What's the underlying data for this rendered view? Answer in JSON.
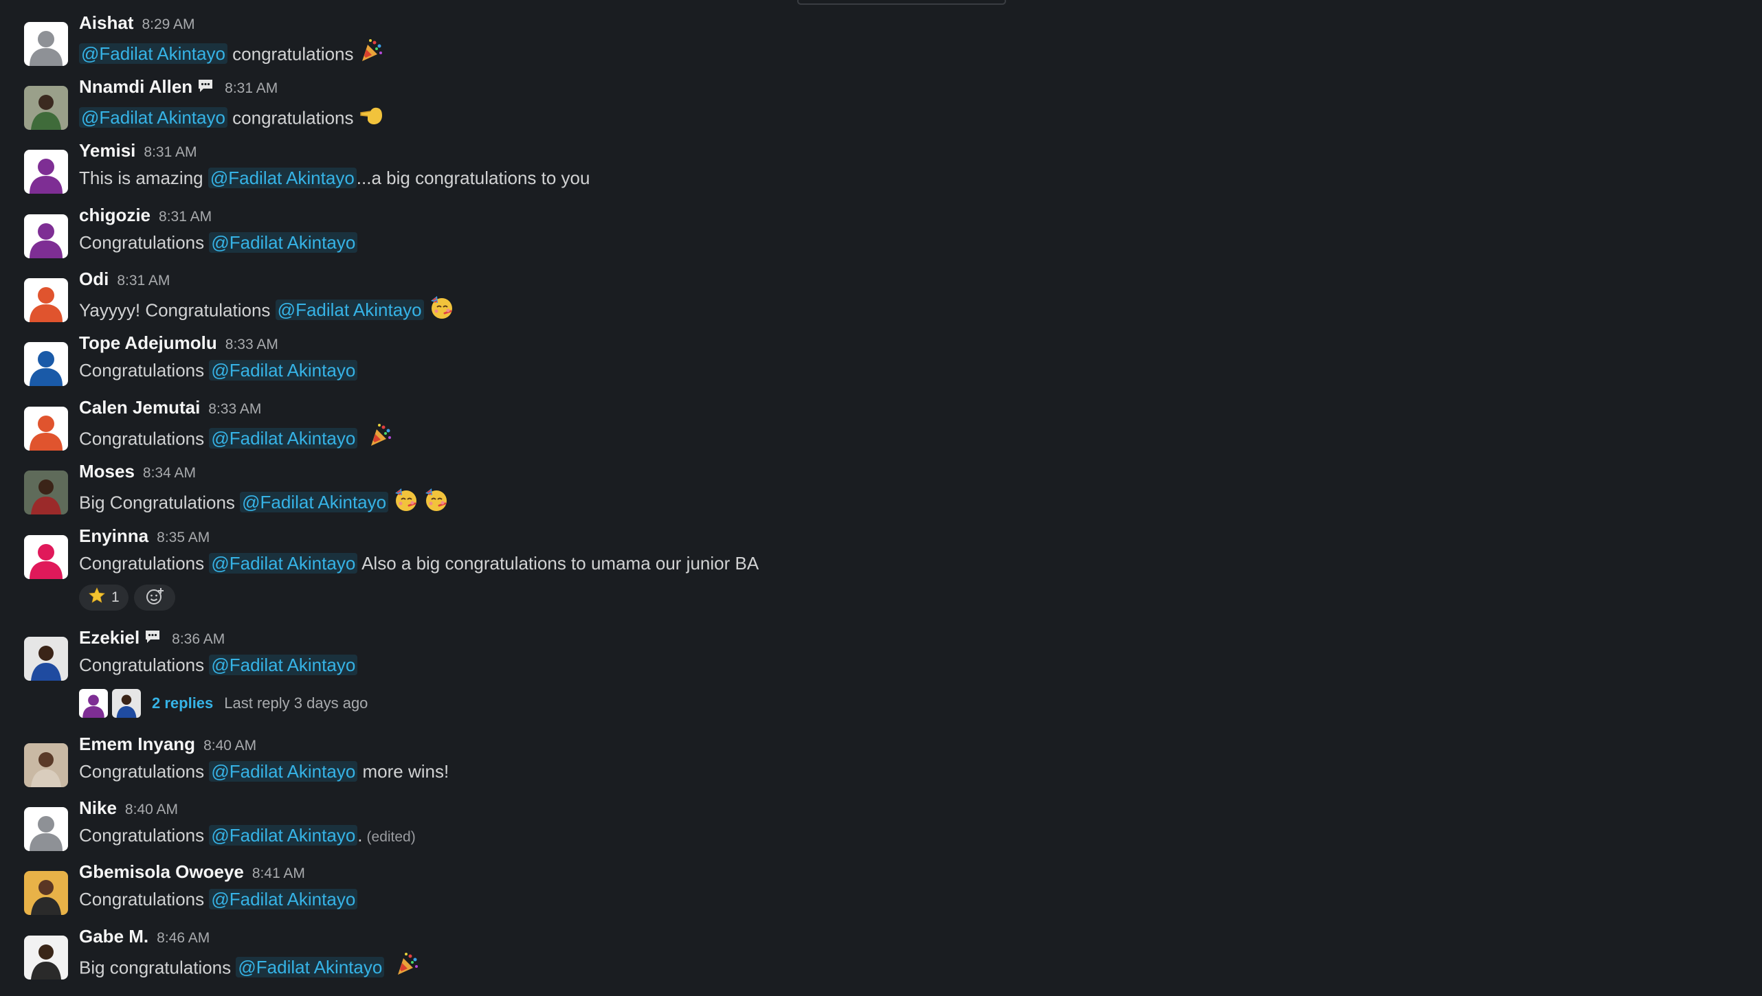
{
  "mention": "@Fadilat Akintayo",
  "colors": {
    "background": "#1a1d21",
    "mention": "#36b3e6",
    "mention_bg": "#1d3a4a"
  },
  "messages": [
    {
      "name": "Aishat",
      "time": "8:29 AM",
      "avatar": "gray-placeholder",
      "pre": "",
      "post": " congratulations",
      "emoji": [
        "party-popper"
      ]
    },
    {
      "name": "Nnamdi Allen",
      "time": "8:31 AM",
      "avatar": "photo-green",
      "thread_icon": true,
      "pre": "",
      "post": " congratulations",
      "emoji": [
        "pointing-hand"
      ]
    },
    {
      "name": "Yemisi",
      "time": "8:31 AM",
      "avatar": "purple-placeholder",
      "pre": "This is amazing ",
      "post": "...a big congratulations to you",
      "emoji": []
    },
    {
      "name": "chigozie",
      "time": "8:31 AM",
      "avatar": "purple-placeholder",
      "pre": "Congratulations ",
      "post": "",
      "emoji": []
    },
    {
      "name": "Odi",
      "time": "8:31 AM",
      "avatar": "orange-placeholder",
      "pre": "Yayyyy! Congratulations ",
      "post": "",
      "emoji": [
        "partying-face"
      ]
    },
    {
      "name": "Tope Adejumolu",
      "time": "8:33 AM",
      "avatar": "blue-placeholder",
      "pre": "Congratulations ",
      "post": "",
      "emoji": []
    },
    {
      "name": "Calen Jemutai",
      "time": "8:33 AM",
      "avatar": "orange-placeholder",
      "pre": "Congratulations ",
      "post": " ",
      "emoji": [
        "party-popper"
      ]
    },
    {
      "name": "Moses",
      "time": "8:34 AM",
      "avatar": "photo-red",
      "pre": "Big Congratulations ",
      "post": "",
      "emoji": [
        "partying-face",
        "partying-face"
      ]
    },
    {
      "name": "Enyinna",
      "time": "8:35 AM",
      "avatar": "pink-placeholder",
      "pre": "Congratulations ",
      "post": " Also a big congratulations to umama our junior BA",
      "emoji": [],
      "reactions": [
        {
          "emoji": "star",
          "count": "1"
        }
      ]
    },
    {
      "name": "Ezekiel",
      "time": "8:36 AM",
      "avatar": "photo-blue",
      "thread_icon": true,
      "pre": "Congratulations ",
      "post": "",
      "emoji": [],
      "thread": {
        "replies": "2 replies",
        "last_reply": "Last reply 3 days ago"
      }
    },
    {
      "name": "Emem Inyang",
      "time": "8:40 AM",
      "avatar": "photo-light",
      "pre": "Congratulations ",
      "post": " more wins!",
      "emoji": []
    },
    {
      "name": "Nike",
      "time": "8:40 AM",
      "avatar": "gray-placeholder",
      "pre": "Congratulations ",
      "post": ".",
      "edited": "(edited)",
      "emoji": []
    },
    {
      "name": "Gbemisola Owoeye",
      "time": "8:41 AM",
      "avatar": "photo-yellow",
      "pre": "Congratulations ",
      "post": "",
      "emoji": []
    },
    {
      "name": "Gabe M.",
      "time": "8:46 AM",
      "avatar": "photo-white",
      "pre": "Big congratulations ",
      "post": " ",
      "emoji": [
        "party-popper"
      ]
    }
  ]
}
